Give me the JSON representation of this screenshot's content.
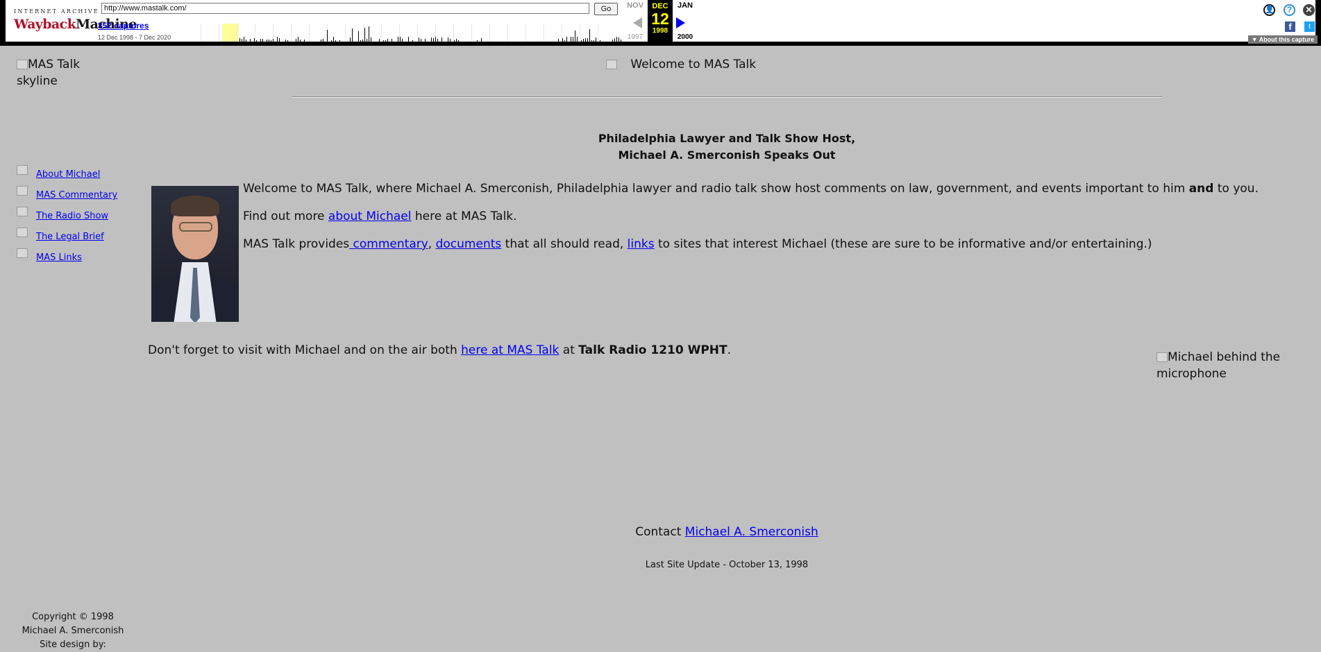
{
  "wayback": {
    "logo_top": "INTERNET ARCHIVE",
    "logo_main_a": "Wayback",
    "logo_main_b": "Machine",
    "url": "http://www.mastalk.com/",
    "go_label": "Go",
    "captures": "352 captures",
    "range": "12 Dec 1998 - 7 Dec 2020",
    "prev_month": "NOV",
    "cur_month": "DEC",
    "next_month": "JAN",
    "cur_day": "12",
    "prev_year": "1997",
    "cur_year": "1998",
    "next_year": "2000",
    "about_capture": "▼ About this capture"
  },
  "page": {
    "skyline_alt": "MAS Talk skyline",
    "welcome_alt": "Welcome to MAS Talk",
    "nav": [
      {
        "label": "About Michael"
      },
      {
        "label": "MAS Commentary"
      },
      {
        "label": "The Radio Show"
      },
      {
        "label": "The Legal Brief"
      },
      {
        "label": "MAS Links"
      }
    ],
    "headline_1": "Philadelphia Lawyer and Talk Show Host,",
    "headline_2": "Michael A. Smerconish Speaks Out",
    "p1_a": "Welcome to MAS Talk, where Michael A. Smerconish, Philadelphia lawyer and radio talk show host comments on law, government, and events important to him ",
    "p1_b": "and",
    "p1_c": " to you.",
    "p2_a": "Find out more ",
    "p2_link": "about Michael",
    "p2_b": " here at MAS Talk.",
    "p3_a": "MAS Talk provides",
    "p3_link1": " commentary",
    "p3_sep": ", ",
    "p3_link2": "documents",
    "p3_b": " that all should read, ",
    "p3_link3": "links",
    "p3_c": " to sites that interest Michael (these are sure to be informative and/or entertaining.)",
    "onair_a": "Don't forget to visit with Michael and on the air both ",
    "onair_link": "here at MAS Talk",
    "onair_b": " at ",
    "onair_station": "Talk Radio 1210 WPHT",
    "onair_c": ".",
    "mic_alt": "Michael behind the microphone",
    "contact_label": "Contact ",
    "contact_link": "Michael A. Smerconish",
    "last_update": "Last Site Update - October 13, 1998",
    "copyright_1": "Copyright © 1998",
    "copyright_2": "Michael A. Smerconish",
    "copyright_3": "Site design by:"
  }
}
